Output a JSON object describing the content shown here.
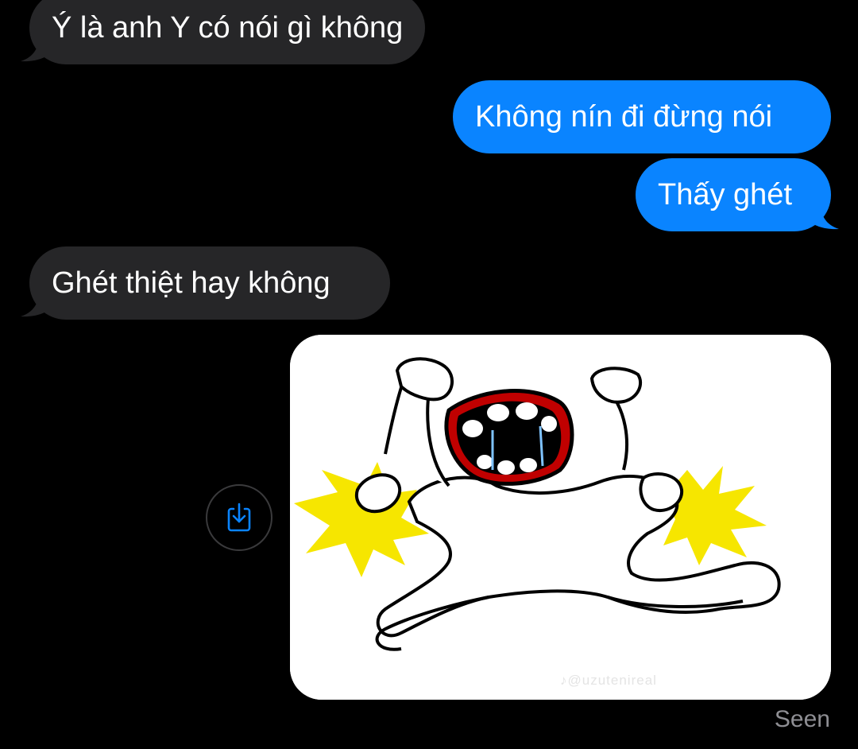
{
  "messages": [
    {
      "direction": "incoming",
      "text": "Ý là anh Y có nói gì không"
    },
    {
      "direction": "outgoing",
      "text": "Không nín đi đừng nói"
    },
    {
      "direction": "outgoing",
      "text": "Thấy ghét"
    },
    {
      "direction": "incoming",
      "text": "Ghét thiệt hay không"
    }
  ],
  "image_message": {
    "description_icon": "crying-tantrum-cartoon",
    "watermark": "♪@uzutenireal"
  },
  "status": {
    "seen": "Seen"
  },
  "colors": {
    "background": "#000000",
    "incoming_bubble": "#262628",
    "outgoing_bubble": "#0a84ff",
    "save_icon": "#0a84ff"
  },
  "icons": {
    "save": "share-download-icon"
  }
}
